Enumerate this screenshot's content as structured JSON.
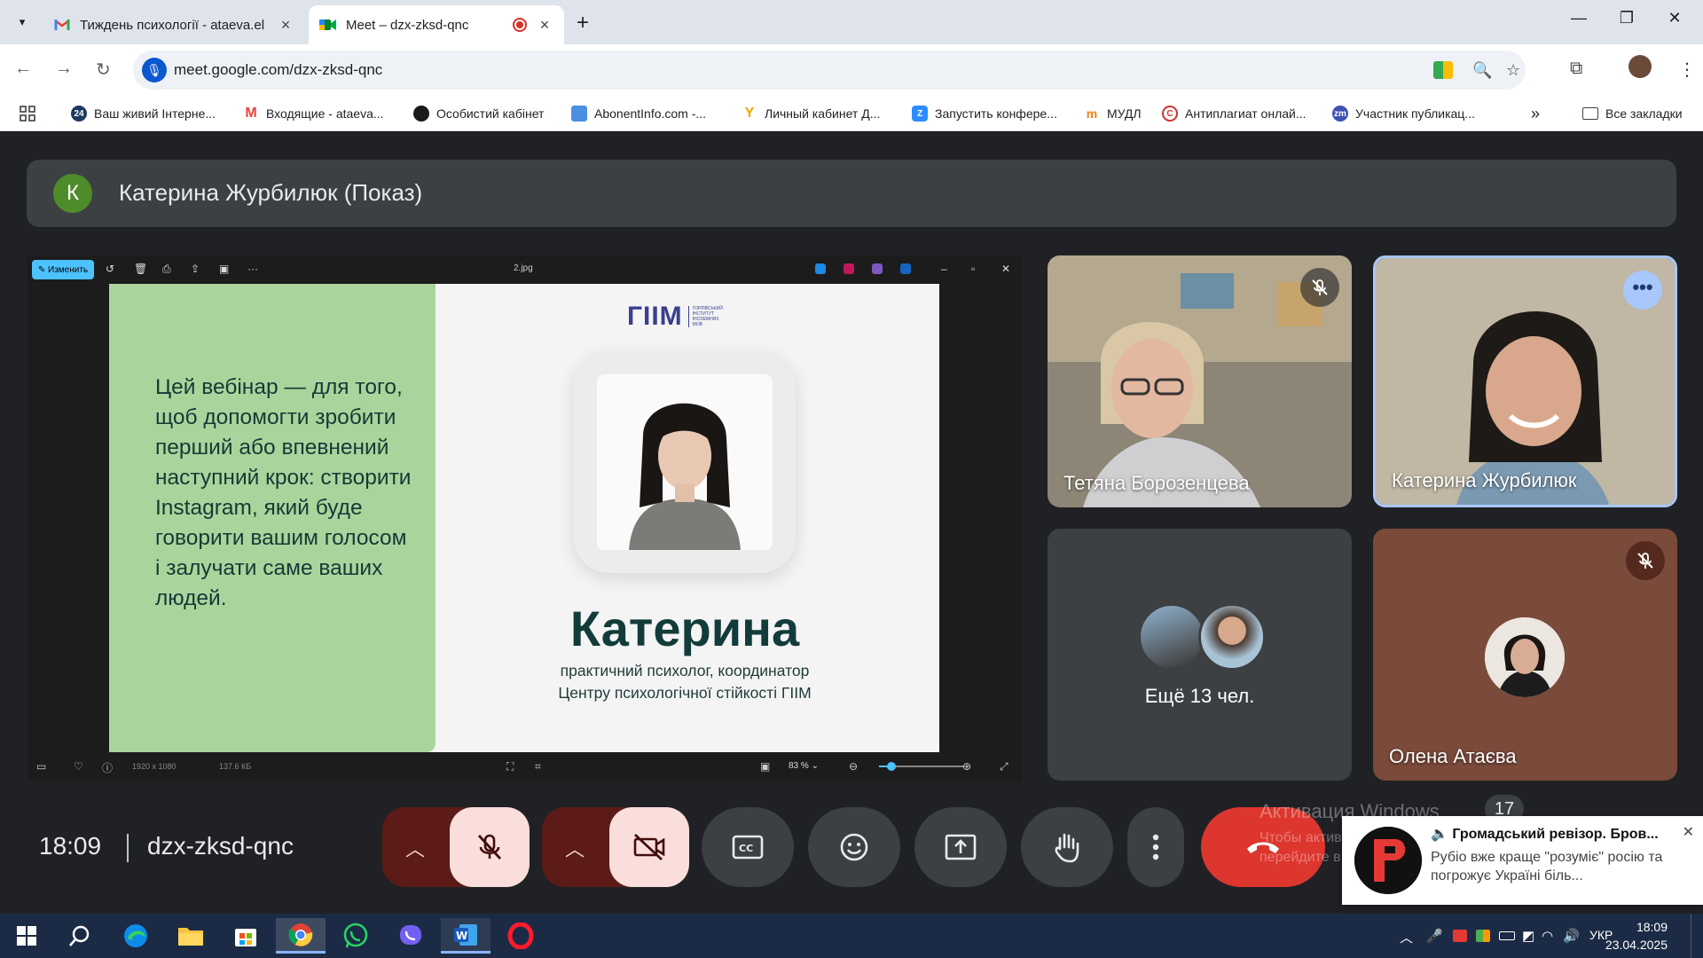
{
  "browser": {
    "tabs": [
      {
        "title": "Тиждень психології - ataeva.el"
      },
      {
        "title": "Meet – dzx-zksd-qnc"
      }
    ],
    "url": "meet.google.com/dzx-zksd-qnc",
    "bookmarks": [
      {
        "label": "Ваш живий Інтерне..."
      },
      {
        "label": "Входящие - ataeva..."
      },
      {
        "label": "Особистий кабінет"
      },
      {
        "label": "AbonentInfo.com -..."
      },
      {
        "label": "Личный кабинет Д..."
      },
      {
        "label": "Запустить конфере..."
      },
      {
        "label": "МУДЛ"
      },
      {
        "label": "Антиплагиат онлай..."
      },
      {
        "label": "Участник публикац..."
      }
    ],
    "all_bookmarks": "Все закладки",
    "bookmark_24_badge": "24"
  },
  "meet": {
    "presenter_initial": "К",
    "presenter_label": "Катерина Журбилюк (Показ)",
    "viewer": {
      "edit_label": "Изменить",
      "file_name": "2.jpg",
      "dimensions": "1920 x 1080",
      "file_size": "137.6 КБ",
      "zoom": "83 %",
      "zoom_level": 0.15
    },
    "slide": {
      "logo": "ГІІМ",
      "logo_sub": "ГОРЛІВСЬКИЙ ІНСТИТУТ ІНОЗЕМНИХ МОВ",
      "text": "Цей вебінар — для того, щоб допомогти зробити перший або впевнений наступний крок: створити Instagram, який буде говорити вашим голосом і залучати саме ваших людей.",
      "name": "Катерина",
      "role_line1": "практичний психолог, координатор",
      "role_line2": "Центру психологічної стійкості ГІІМ"
    },
    "participants": [
      {
        "name": "Тетяна Борозенцева"
      },
      {
        "name": "Катерина Журбилюк"
      },
      {
        "name": "Ещё 13 чел."
      },
      {
        "name": "Олена Атаєва"
      }
    ],
    "time": "18:09",
    "code": "dzx-zksd-qnc",
    "people_count": "17",
    "activate_title": "Активация Windows",
    "activate_text": "Чтобы активировать Windows, перейдите в раздел \"Параметры\"."
  },
  "notification": {
    "title": "Громадський ревізор. Бров...",
    "body": "Рубіо вже краще \"розуміє\" росію та погрожує Україні біль..."
  },
  "taskbar": {
    "lang": "УКР",
    "time": "18:09",
    "date": "23.04.2025"
  },
  "colors": {
    "meet_bg": "#202124",
    "tile_bg": "#3c4043",
    "end_call": "#dc362e",
    "slide_green": "#a9d59c",
    "slide_text": "#123c39"
  }
}
